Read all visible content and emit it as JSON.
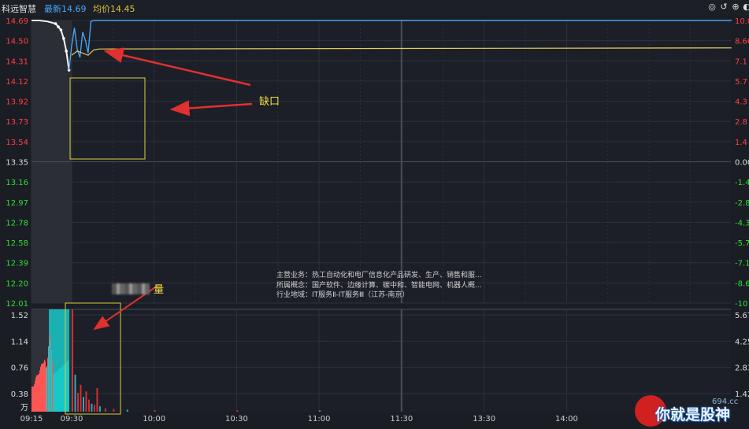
{
  "header": {
    "stock_name": "科远智慧",
    "latest_label": "最新14.69",
    "avg_label": "均价14.45"
  },
  "icons": [
    "settings-icon",
    "undo-icon",
    "add-icon",
    "expand-icon"
  ],
  "price_axis": {
    "labels": [
      "14.69",
      "14.50",
      "14.31",
      "14.12",
      "13.92",
      "13.73",
      "13.54",
      "13.35",
      "13.16",
      "12.97",
      "12.78",
      "12.58",
      "12.39",
      "12.20",
      "12.01"
    ],
    "up_color": "#ff4040",
    "base_color": "#dddddd",
    "down_color": "#33dd33"
  },
  "pct_axis": {
    "labels": [
      "10.0",
      "8.66",
      "7.1",
      "5.7",
      "4.3",
      "2.8",
      "1.4",
      "0.00",
      "-1.4",
      "-2.8",
      "-4.3",
      "-5.7",
      "-7.1",
      "-8.6",
      "-10"
    ]
  },
  "volume_axis": {
    "labels": [
      "1.52",
      "1.14",
      "0.76",
      "0.38"
    ],
    "unit": "万",
    "right_labels": [
      "5.67",
      "4.25",
      "2.83",
      "1.42"
    ]
  },
  "time_axis": {
    "labels": [
      "09:15",
      "09:30",
      "10:00",
      "10:30",
      "11:00",
      "11:30",
      "13:30",
      "14:00"
    ]
  },
  "annotations": {
    "gap_label": "缺口",
    "volume_label": "量"
  },
  "info": {
    "line1": "主营业务：热工自动化和电厂信息化产品研发、生产、销售和服...",
    "line2": "所属概念：国产软件、边缘计算、碳中和、智能电网、机器人概...",
    "line3": "行业地域：IT服务Ⅱ-IT服务Ⅲ（江苏-南京）"
  },
  "watermark": {
    "text": "你就是股神",
    "sub": "694.cc"
  },
  "chart_data": {
    "type": "line",
    "title": "",
    "x_range": [
      "09:15",
      "15:00"
    ],
    "y_range": [
      12.01,
      14.69
    ],
    "pct_range": [
      -10,
      10
    ],
    "prev_close": 13.35,
    "series": [
      {
        "x": [
          "09:15",
          "09:18",
          "09:21",
          "09:24",
          "09:25",
          "09:26",
          "09:27",
          "09:28",
          "09:29",
          "09:30",
          "09:31",
          "09:32",
          "09:33",
          "09:34",
          "09:35",
          "09:36",
          "09:37",
          "09:38",
          "09:40",
          "15:00"
        ],
        "y": [
          14.69,
          14.69,
          14.68,
          14.66,
          14.63,
          14.6,
          14.52,
          14.4,
          14.22,
          14.45,
          14.62,
          14.42,
          14.34,
          14.58,
          14.5,
          14.38,
          14.68,
          14.69,
          14.69,
          14.69
        ]
      },
      {
        "x": [
          "09:30",
          "09:32",
          "09:34",
          "09:36",
          "09:38",
          "09:40",
          "15:00"
        ],
        "y": [
          14.36,
          14.4,
          14.38,
          14.36,
          14.41,
          14.42,
          14.43
        ]
      }
    ],
    "volume": {
      "auction_x": [
        "09:15",
        "09:20",
        "09:25"
      ],
      "auction_y": [
        1.52,
        1.52,
        1.52
      ],
      "bars_x": [
        "09:30",
        "09:31",
        "09:32",
        "09:33",
        "09:34",
        "09:35",
        "09:36",
        "09:37",
        "09:38",
        "09:39",
        "09:40",
        "09:42",
        "09:45",
        "09:50",
        "10:00",
        "10:30",
        "11:00"
      ],
      "bars_y": [
        1.52,
        0.55,
        0.28,
        0.4,
        0.22,
        0.3,
        0.18,
        0.12,
        0.1,
        0.35,
        0.08,
        0.05,
        0.04,
        0.03,
        0.02,
        0.02,
        0.02
      ],
      "ylim": [
        0,
        1.52
      ]
    }
  }
}
